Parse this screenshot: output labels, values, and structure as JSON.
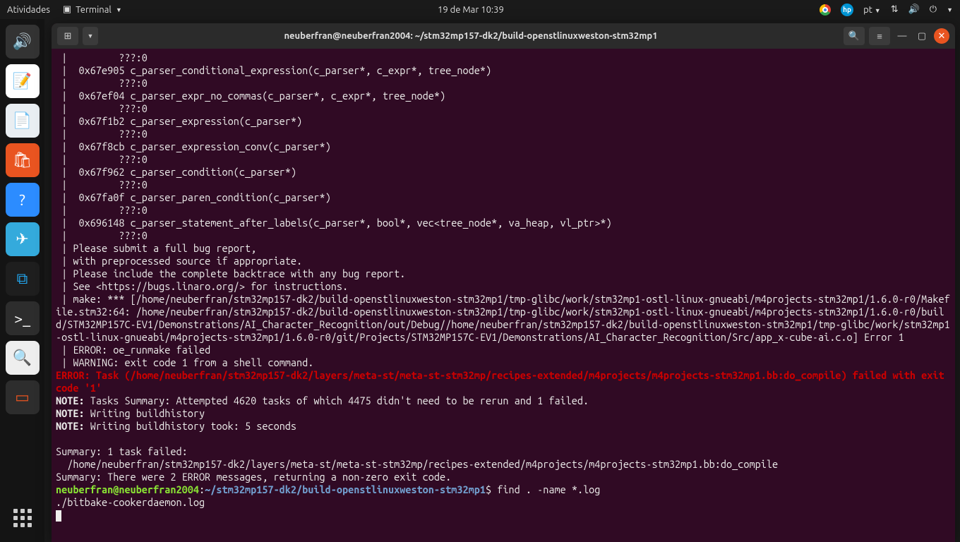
{
  "topbar": {
    "activities": "Atividades",
    "app_name": "Terminal",
    "datetime": "19 de Mar  10:39",
    "lang": "pt"
  },
  "window": {
    "title": "neuberfran@neuberfran2004: ~/stm32mp157-dk2/build-openstlinuxweston-stm32mp1"
  },
  "term": {
    "l1": " |         ???:0",
    "l2": " |  0x67e905 c_parser_conditional_expression(c_parser*, c_expr*, tree_node*)",
    "l3": " |         ???:0",
    "l4": " |  0x67ef04 c_parser_expr_no_commas(c_parser*, c_expr*, tree_node*)",
    "l5": " |         ???:0",
    "l6": " |  0x67f1b2 c_parser_expression(c_parser*)",
    "l7": " |         ???:0",
    "l8": " |  0x67f8cb c_parser_expression_conv(c_parser*)",
    "l9": " |         ???:0",
    "l10": " |  0x67f962 c_parser_condition(c_parser*)",
    "l11": " |         ???:0",
    "l12": " |  0x67fa0f c_parser_paren_condition(c_parser*)",
    "l13": " |         ???:0",
    "l14": " |  0x696148 c_parser_statement_after_labels(c_parser*, bool*, vec<tree_node*, va_heap, vl_ptr>*)",
    "l15": " |         ???:0",
    "l16": " | Please submit a full bug report,",
    "l17": " | with preprocessed source if appropriate.",
    "l18": " | Please include the complete backtrace with any bug report.",
    "l19": " | See <https://bugs.linaro.org/> for instructions.",
    "l20": " | make: *** [/home/neuberfran/stm32mp157-dk2/build-openstlinuxweston-stm32mp1/tmp-glibc/work/stm32mp1-ostl-linux-gnueabi/m4projects-stm32mp1/1.6.0-r0/Makefile.stm32:64: /home/neuberfran/stm32mp157-dk2/build-openstlinuxweston-stm32mp1/tmp-glibc/work/stm32mp1-ostl-linux-gnueabi/m4projects-stm32mp1/1.6.0-r0/build/STM32MP157C-EV1/Demonstrations/AI_Character_Recognition/out/Debug//home/neuberfran/stm32mp157-dk2/build-openstlinuxweston-stm32mp1/tmp-glibc/work/stm32mp1-ostl-linux-gnueabi/m4projects-stm32mp1/1.6.0-r0/git/Projects/STM32MP157C-EV1/Demonstrations/AI_Character_Recognition/Src/app_x-cube-ai.c.o] Error 1",
    "l21": " | ERROR: oe_runmake failed",
    "l22": " | WARNING: exit code 1 from a shell command.",
    "err_label": "ERROR:",
    "err_msg": " Task (/home/neuberfran/stm32mp157-dk2/layers/meta-st/meta-st-stm32mp/recipes-extended/m4projects/m4projects-stm32mp1.bb:do_compile) failed with exit code '1'",
    "note_label": "NOTE:",
    "n1": " Tasks Summary: Attempted 4620 tasks of which 4475 didn't need to be rerun and 1 failed.",
    "n2": " Writing buildhistory",
    "n3": " Writing buildhistory took: 5 seconds",
    "blank": "",
    "s1": "Summary: 1 task failed:",
    "s2": "  /home/neuberfran/stm32mp157-dk2/layers/meta-st/meta-st-stm32mp/recipes-extended/m4projects/m4projects-stm32mp1.bb:do_compile",
    "s3": "Summary: There were 2 ERROR messages, returning a non-zero exit code.",
    "prompt_user": "neuberfran@neuberfran2004",
    "prompt_colon": ":",
    "prompt_path": "~/stm32mp157-dk2/build-openstlinuxweston-stm32mp1",
    "prompt_dollar": "$ ",
    "cmd": "find . -name *.log",
    "out1": "./bitbake-cookerdaemon.log"
  }
}
